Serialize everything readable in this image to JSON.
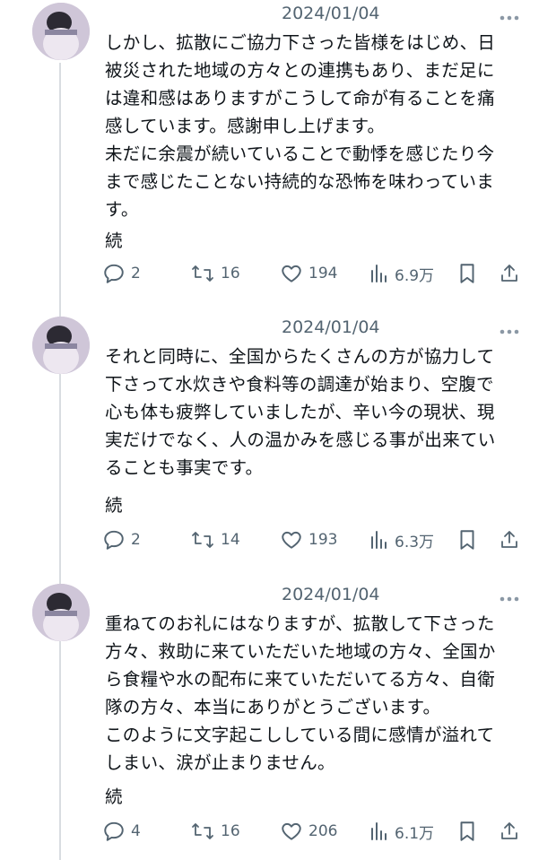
{
  "tweets": [
    {
      "date": "2024/01/04",
      "text": "しかし、拡散にご協力下さった皆様をはじめ、日\n被災された地域の方々との連携もあり、まだ足に\nは違和感はありますがこうして命が有ることを痛\n感しています。感謝申し上げます。\n未だに余震が続いていることで動悸を感じたり今\nまで感じたことない持続的な恐怖を味わっていま\nす。",
      "continued": "続",
      "replies": "2",
      "retweets": "16",
      "likes": "194",
      "views": "6.9万"
    },
    {
      "date": "2024/01/04",
      "text": "それと同時に、全国からたくさんの方が協力して\n下さって水炊きや食料等の調達が始まり、空腹で\n心も体も疲弊していましたが、辛い今の現状、現\n実だけでなく、人の温かみを感じる事が出来てい\nることも事実です。",
      "continued": "続",
      "replies": "2",
      "retweets": "14",
      "likes": "193",
      "views": "6.3万"
    },
    {
      "date": "2024/01/04",
      "text": "重ねてのお礼にはなりますが、拡散して下さった\n方々、救助に来ていただいた地域の方々、全国か\nら食糧や水の配布に来ていただいてる方々、自衛\n隊の方々、本当にありがとうございます。\nこのように文字起こししている間に感情が溢れて\nしまい、涙が止まりません。",
      "continued": "続",
      "replies": "4",
      "retweets": "16",
      "likes": "206",
      "views": "6.1万"
    }
  ],
  "icons": {
    "reply": "speech-bubble-icon",
    "retweet": "retweet-arrows-icon",
    "like": "heart-icon",
    "views": "bar-chart-icon",
    "bookmark": "bookmark-icon",
    "share": "share-upload-icon",
    "more": "more-dots-icon"
  },
  "colors": {
    "text": "#0f1419",
    "secondary": "#536471",
    "thread_line": "#d9dde1"
  }
}
